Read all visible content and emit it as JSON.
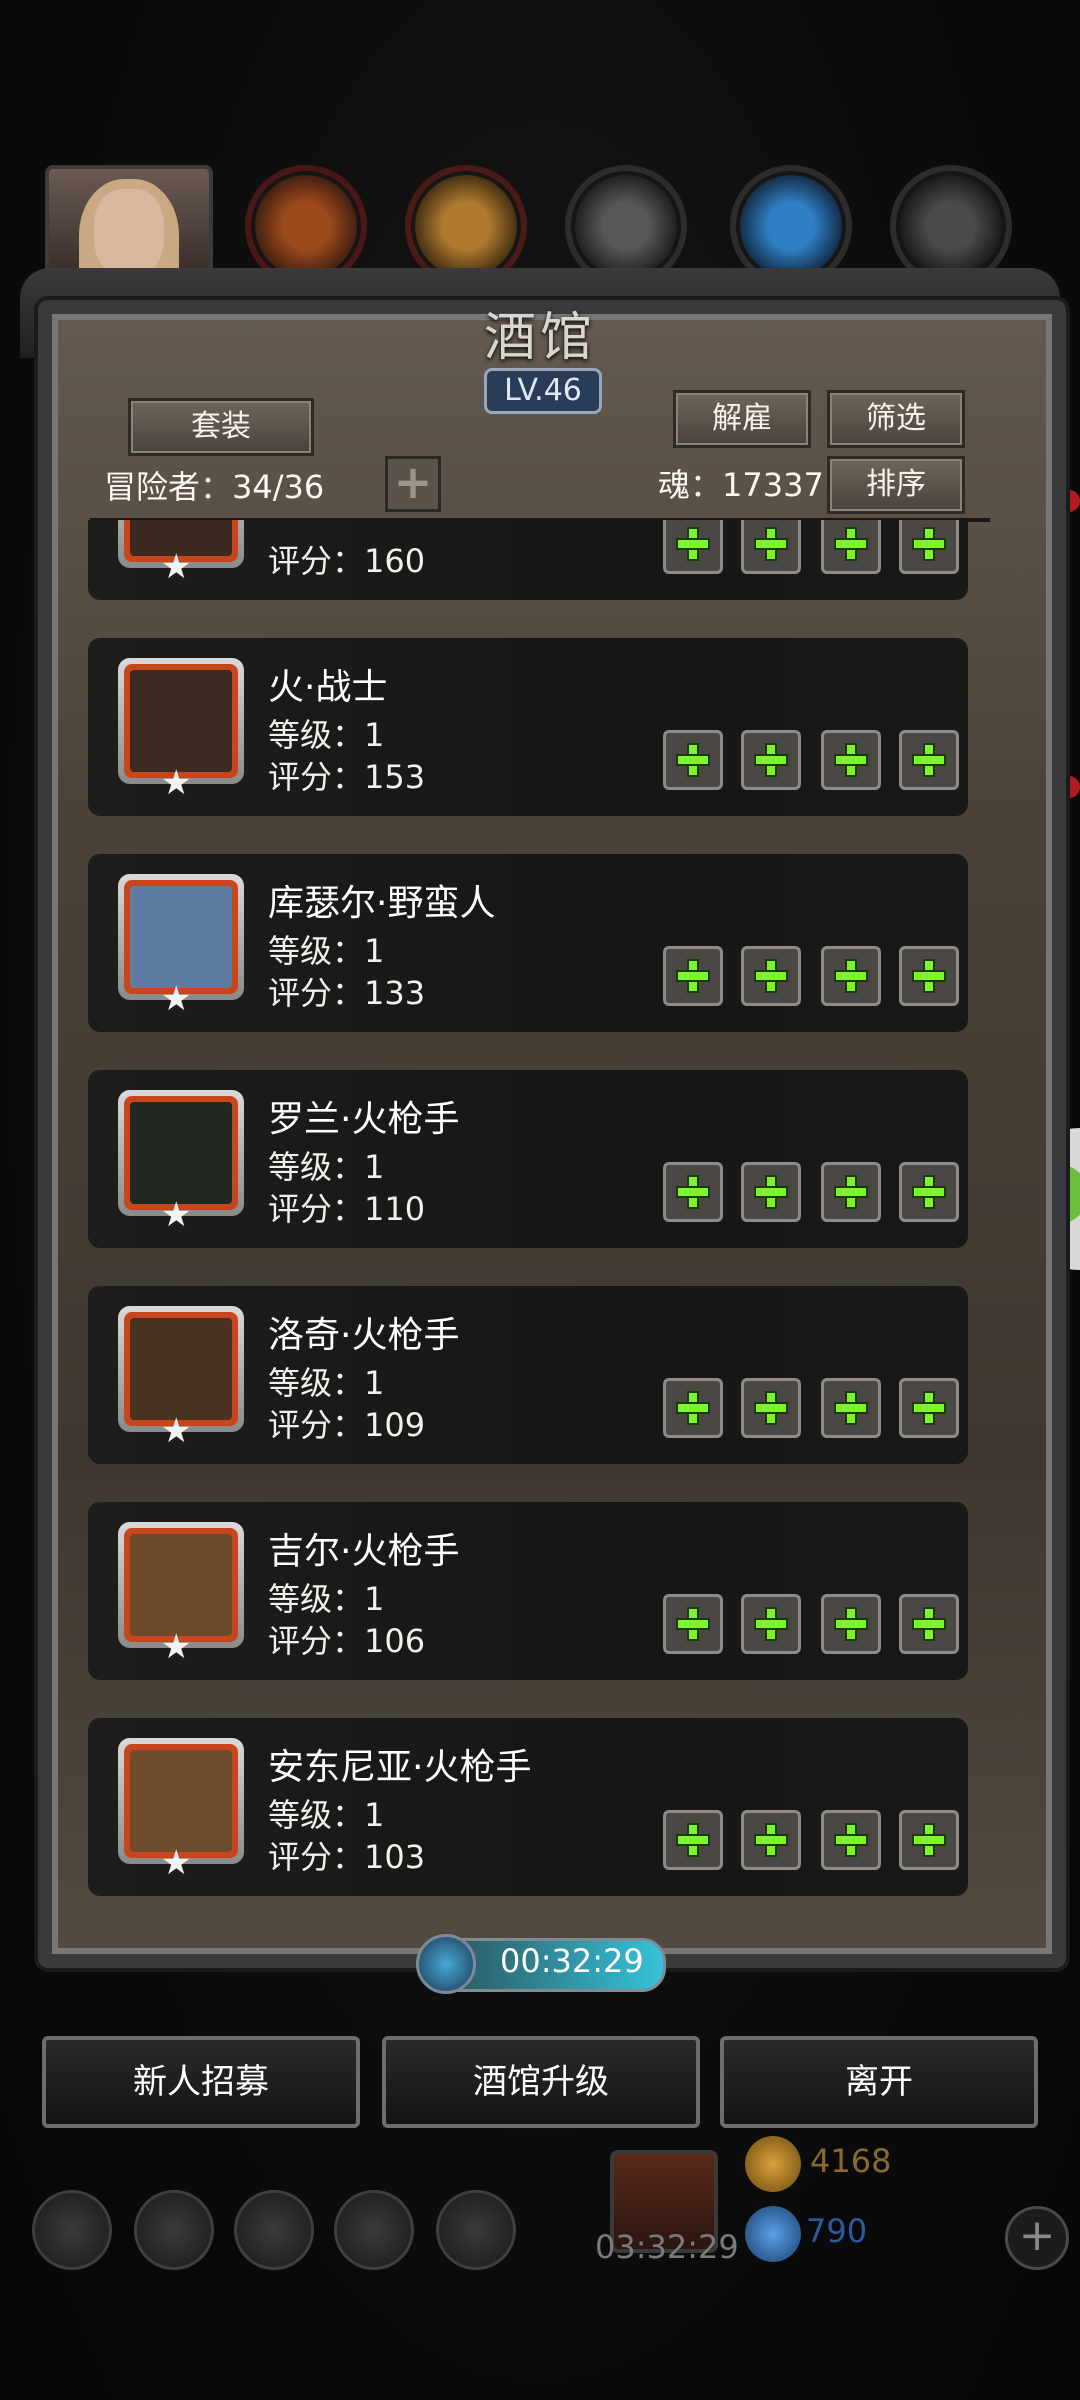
{
  "header": {
    "title": "酒馆",
    "level": "LV.46",
    "set_label": "套装",
    "fire_label": "解雇",
    "filter_label": "筛选",
    "sort_label": "排序",
    "adventurers": "冒险者：34/36",
    "soul": "魂：17337"
  },
  "partial_top": {
    "score": "评分：160"
  },
  "heroes": [
    {
      "name": "火·战士",
      "level": "等级：1",
      "score": "评分：153",
      "portrait_color": "#3b2b22"
    },
    {
      "name": "库瑟尔·野蛮人",
      "level": "等级：1",
      "score": "评分：133",
      "portrait_color": "#5d7da3"
    },
    {
      "name": "罗兰·火枪手",
      "level": "等级：1",
      "score": "评分：110",
      "portrait_color": "#202820"
    },
    {
      "name": "洛奇·火枪手",
      "level": "等级：1",
      "score": "评分：109",
      "portrait_color": "#4a3220"
    },
    {
      "name": "吉尔·火枪手",
      "level": "等级：1",
      "score": "评分：106",
      "portrait_color": "#6a4a2a"
    },
    {
      "name": "安东尼亚·火枪手",
      "level": "等级：1",
      "score": "评分：103",
      "portrait_color": "#6f4c2c"
    }
  ],
  "timer": "00:32:29",
  "actions": {
    "recruit": "新人招募",
    "upgrade": "酒馆升级",
    "leave": "离开"
  },
  "bottom": {
    "gift_timer": "03:32:29",
    "gold": "4168",
    "gems": "790"
  },
  "colors": {
    "accent_green": "#7cf52b",
    "frame_orange": "#c8461e"
  },
  "icons": [
    "sword-plus-icon",
    "armor-plus-icon",
    "ring-plus-icon",
    "amulet-plus-icon"
  ]
}
